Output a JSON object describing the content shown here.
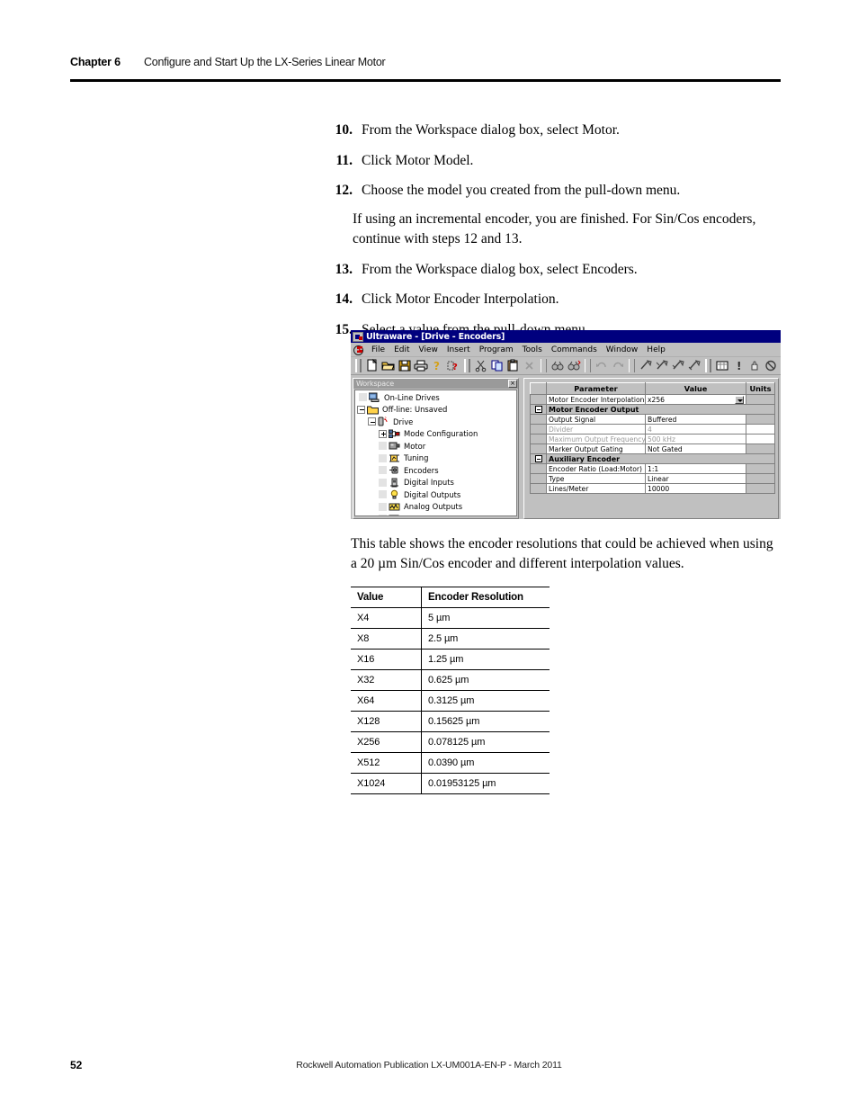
{
  "header": {
    "chapter_label": "Chapter 6",
    "chapter_title": "Configure and Start Up the LX-Series Linear Motor"
  },
  "steps": [
    {
      "num": "10.",
      "text": "From the Workspace dialog box, select Motor."
    },
    {
      "num": "11.",
      "text": "Click Motor Model."
    },
    {
      "num": "12.",
      "text": "Choose the model you created from the pull-down menu."
    },
    {
      "num": "13.",
      "text": "From the Workspace dialog box, select Encoders."
    },
    {
      "num": "14.",
      "text": "Click Motor Encoder Interpolation."
    },
    {
      "num": "15.",
      "text": "Select a value from the pull-down menu."
    }
  ],
  "step_note": "If using an incremental encoder, you are finished. For Sin/Cos encoders, continue with steps 12 and 13.",
  "app": {
    "title": "Ultraware - [Drive - Encoders]",
    "menu": [
      "File",
      "Edit",
      "View",
      "Insert",
      "Program",
      "Tools",
      "Commands",
      "Window",
      "Help"
    ],
    "toolbar_icons": [
      "new-document-icon",
      "open-folder-icon",
      "save-disk-icon",
      "print-icon",
      "help-about-icon",
      "context-help-icon",
      "cut-scissors-icon",
      "copy-icon",
      "paste-icon",
      "delete-x-icon",
      "find-binoculars-icon",
      "replace-icon",
      "undo-icon",
      "redo-icon",
      "download-icon",
      "upload-icon",
      "transfer-icon",
      "apply-icon",
      "monitor-icon",
      "fault-reset-icon",
      "stop-hand-icon",
      "disable-icon",
      "notes-icon",
      "properties-icon"
    ],
    "workspace": {
      "panel_title": "Workspace",
      "close_label": "×",
      "tree": [
        {
          "label": "On-Line Drives",
          "indent": 0,
          "expander": "none",
          "icon": "online-drives-icon"
        },
        {
          "label": "Off-line: Unsaved",
          "indent": 0,
          "expander": "minus",
          "icon": "folder-icon"
        },
        {
          "label": "Drive",
          "indent": 1,
          "expander": "minus",
          "icon": "drive-icon"
        },
        {
          "label": "Mode Configuration",
          "indent": 2,
          "expander": "plus",
          "icon": "mode-config-icon"
        },
        {
          "label": "Motor",
          "indent": 2,
          "expander": "none",
          "icon": "motor-icon"
        },
        {
          "label": "Tuning",
          "indent": 2,
          "expander": "none",
          "icon": "tuning-icon"
        },
        {
          "label": "Encoders",
          "indent": 2,
          "expander": "none",
          "icon": "encoder-icon"
        },
        {
          "label": "Digital Inputs",
          "indent": 2,
          "expander": "none",
          "icon": "digital-inputs-icon"
        },
        {
          "label": "Digital Outputs",
          "indent": 2,
          "expander": "none",
          "icon": "lightbulb-icon"
        },
        {
          "label": "Analog Outputs",
          "indent": 2,
          "expander": "none",
          "icon": "analog-outputs-icon"
        }
      ]
    },
    "grid": {
      "columns": [
        "",
        "Parameter",
        "Value",
        "Units"
      ],
      "rows": [
        {
          "type": "param",
          "expander": false,
          "parameter": "Motor Encoder Interpolation",
          "value": "x256",
          "units": "",
          "dropdown": true,
          "disabled": false
        },
        {
          "type": "group",
          "expander": true,
          "parameter": "Motor Encoder Output",
          "value": "",
          "units": "",
          "dropdown": false,
          "disabled": false
        },
        {
          "type": "param",
          "expander": false,
          "parameter": "Output Signal",
          "value": "Buffered",
          "units": "",
          "dropdown": false,
          "disabled": false
        },
        {
          "type": "param",
          "expander": false,
          "parameter": "Divider",
          "value": "4",
          "units": "",
          "dropdown": false,
          "disabled": true
        },
        {
          "type": "param",
          "expander": false,
          "parameter": "Maximum Output Frequency",
          "value": "500 kHz",
          "units": "",
          "dropdown": false,
          "disabled": true
        },
        {
          "type": "param",
          "expander": false,
          "parameter": "Marker Output Gating",
          "value": "Not Gated",
          "units": "",
          "dropdown": false,
          "disabled": false
        },
        {
          "type": "group",
          "expander": true,
          "parameter": "Auxiliary Encoder",
          "value": "",
          "units": "",
          "dropdown": false,
          "disabled": false
        },
        {
          "type": "param",
          "expander": false,
          "parameter": "Encoder Ratio (Load:Motor)",
          "value": "1:1",
          "units": "",
          "dropdown": false,
          "disabled": false
        },
        {
          "type": "param",
          "expander": false,
          "parameter": "Type",
          "value": "Linear",
          "units": "",
          "dropdown": false,
          "disabled": false
        },
        {
          "type": "param",
          "expander": false,
          "parameter": "Lines/Meter",
          "value": "10000",
          "units": "",
          "dropdown": false,
          "disabled": false
        }
      ]
    }
  },
  "body_paragraph": "This table shows the encoder resolutions that could be achieved when using a 20 µm Sin/Cos encoder and different interpolation values.",
  "table": {
    "columns": [
      "Value",
      "Encoder Resolution"
    ],
    "rows": [
      [
        "X4",
        "5 µm"
      ],
      [
        "X8",
        "2.5 µm"
      ],
      [
        "X16",
        "1.25 µm"
      ],
      [
        "X32",
        "0.625 µm"
      ],
      [
        "X64",
        "0.3125 µm"
      ],
      [
        "X128",
        "0.15625 µm"
      ],
      [
        "X256",
        "0.078125 µm"
      ],
      [
        "X512",
        "0.0390 µm"
      ],
      [
        "X1024",
        "0.01953125 µm"
      ]
    ]
  },
  "footer": {
    "page_number": "52",
    "publication": "Rockwell Automation Publication LX-UM001A-EN-P - March 2011"
  },
  "colors": {
    "title_bar": "#00007e",
    "window_face": "#c0c0c0",
    "accent_red": "#cc0000"
  }
}
